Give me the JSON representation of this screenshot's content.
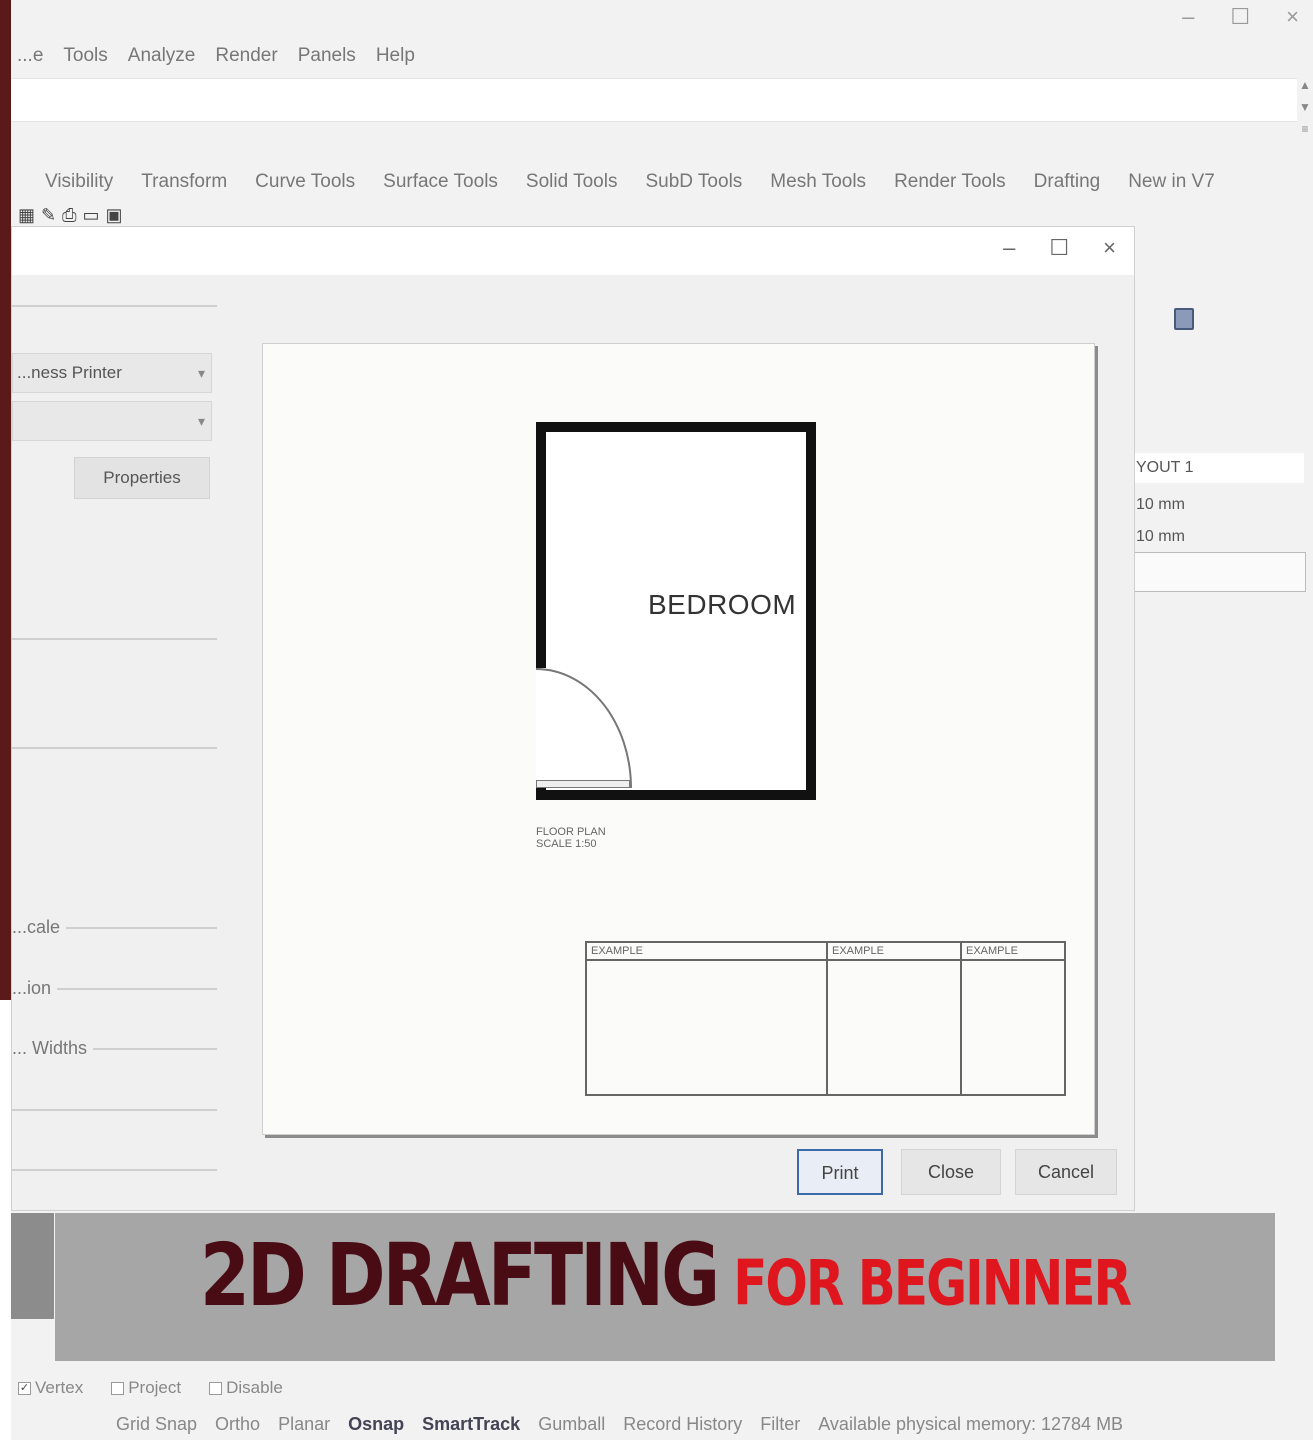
{
  "window": {
    "minimize_label": "–",
    "maximize_label": "☐",
    "close_label": "×"
  },
  "menubar": {
    "items": [
      "...e",
      "Tools",
      "Analyze",
      "Render",
      "Panels",
      "Help"
    ]
  },
  "tabs": {
    "items": [
      "Visibility",
      "Transform",
      "Curve Tools",
      "Surface Tools",
      "Solid Tools",
      "SubD Tools",
      "Mesh Tools",
      "Render Tools",
      "Drafting",
      "New in V7"
    ]
  },
  "right_panel": {
    "row1": "YOUT 1",
    "row2": "10 mm",
    "row3": "10 mm"
  },
  "dialog": {
    "minimize_label": "–",
    "maximize_label": "☐",
    "close_label": "×",
    "destination_value": "...ness Printer",
    "properties_label": "Properties",
    "label_scale": "...cale",
    "label_position": "...ion",
    "label_linewidths": "... Widths",
    "preview": {
      "room_label": "BEDROOM",
      "caption_line1": "FLOOR PLAN",
      "caption_line2": "SCALE 1:50",
      "title_block_headers": [
        "EXAMPLE",
        "EXAMPLE",
        "EXAMPLE"
      ]
    },
    "buttons": {
      "print": "Print",
      "close": "Close",
      "cancel": "Cancel"
    }
  },
  "banner": {
    "main": "2D DRAFTING",
    "sub": "FOR BEGINNER",
    "main_color": "#4a0c14",
    "sub_color": "#e0161e"
  },
  "status": {
    "checkboxes": [
      {
        "label": "Vertex",
        "checked": true
      },
      {
        "label": "Project",
        "checked": false
      },
      {
        "label": "Disable",
        "checked": false
      }
    ],
    "items": [
      "Grid Snap",
      "Ortho",
      "Planar",
      "Osnap",
      "SmartTrack",
      "Gumball",
      "Record History",
      "Filter"
    ],
    "memory": "Available physical memory: 12784 MB"
  }
}
